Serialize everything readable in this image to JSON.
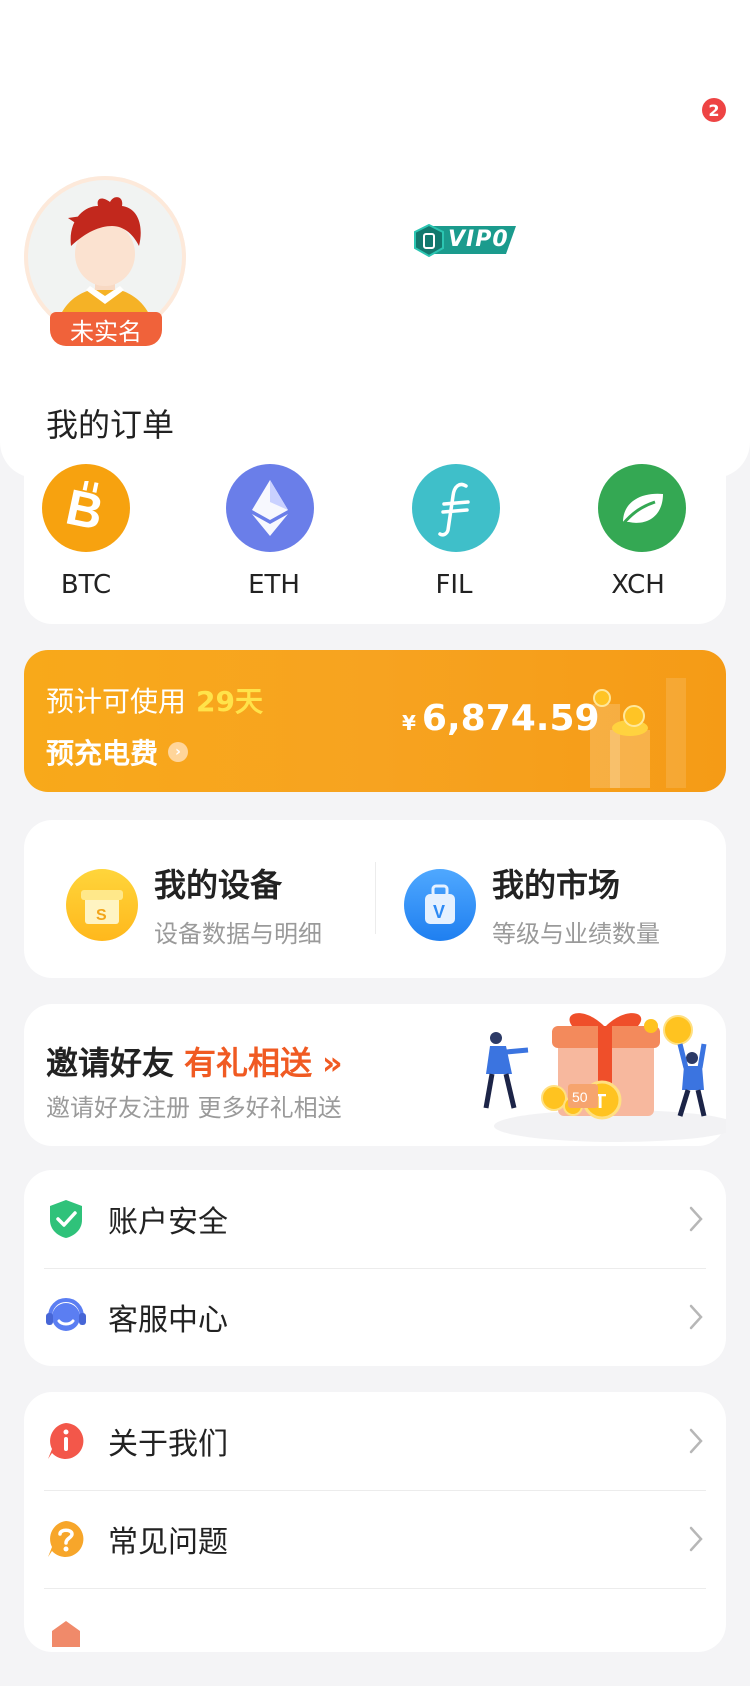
{
  "header": {
    "notification_count": "2",
    "avatar_tag": "未实名",
    "vip_label": "VIP0",
    "vip_level": "0",
    "orders_title": "我的订单"
  },
  "coins": [
    {
      "label": "BTC",
      "color": "#f7a20f",
      "icon": "bitcoin-icon"
    },
    {
      "label": "ETH",
      "color": "#6a7ee9",
      "icon": "ethereum-icon"
    },
    {
      "label": "FIL",
      "color": "#3fbfc9",
      "icon": "filecoin-icon"
    },
    {
      "label": "XCH",
      "color": "#34a853",
      "icon": "chia-leaf-icon"
    }
  ],
  "prepay": {
    "line1": "预计可使用",
    "days": "29天",
    "action": "预充电费",
    "currency": "¥",
    "amount": "6,874.59"
  },
  "device_market": {
    "device_title": "我的设备",
    "device_sub": "设备数据与明细",
    "market_title": "我的市场",
    "market_sub": "等级与业绩数量"
  },
  "invite": {
    "title": "邀请好友",
    "gift": "有礼相送",
    "arrow": "»",
    "sub": "邀请好友注册 更多好礼相送",
    "voucher": "50"
  },
  "menu_group1": [
    {
      "label": "账户安全",
      "icon": "shield-check-icon"
    },
    {
      "label": "客服中心",
      "icon": "headset-icon"
    }
  ],
  "menu_group2": [
    {
      "label": "关于我们",
      "icon": "info-icon"
    },
    {
      "label": "常见问题",
      "icon": "question-icon"
    }
  ],
  "colors": {
    "accent_orange": "#f7a320",
    "highlight_yellow": "#ffe34a",
    "invite_red": "#f05a22",
    "badge_red": "#ee4444"
  }
}
